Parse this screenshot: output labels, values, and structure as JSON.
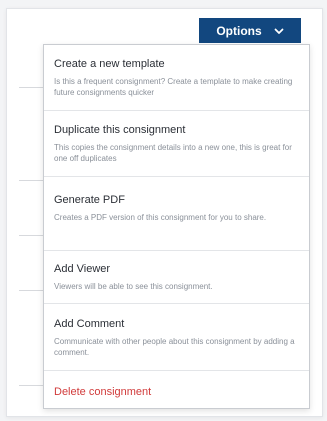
{
  "header": {
    "options_label": "Options",
    "options_icon": "chevron-down-icon"
  },
  "menu": {
    "items": [
      {
        "title": "Create a new template",
        "description": "Is this a frequent consignment? Create a template to make creating future consignments quicker"
      },
      {
        "title": "Duplicate this consignment",
        "description": "This copies the consignment details into a new one, this is great for one off duplicates"
      },
      {
        "title": "Generate PDF",
        "description": "Creates a PDF version of this consignment for you to share."
      },
      {
        "title": "Add Viewer",
        "description": "Viewers will be able to see this consignment."
      },
      {
        "title": "Add Comment",
        "description": "Communicate with other people about this consignment by adding a comment."
      }
    ],
    "danger_item": {
      "title": "Delete consignment"
    }
  },
  "colors": {
    "primary": "#12477f",
    "danger": "#d13b3b",
    "text": "#2b2f36",
    "muted": "#8a9099"
  }
}
